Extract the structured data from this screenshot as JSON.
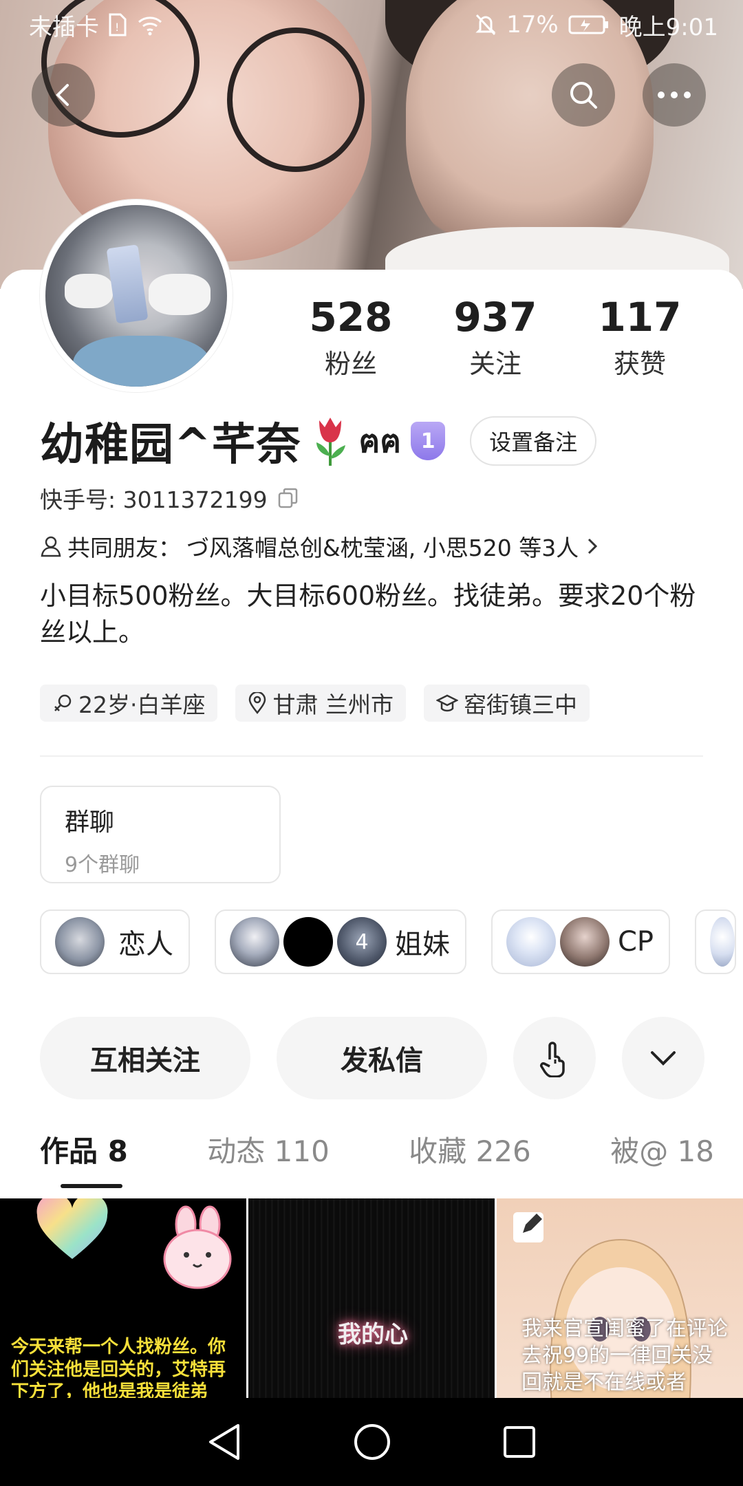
{
  "status_bar": {
    "carrier": "未插卡",
    "battery": "17%",
    "time": "晚上9:01"
  },
  "profile": {
    "name": "幼稚园^芊奈",
    "kaomoji": "ฅฅ",
    "badge_level": "1",
    "remark_button": "设置备注",
    "uid_label": "快手号:",
    "uid": "3011372199",
    "mutual_label": "共同朋友：",
    "mutual_text": "づ风落帽总创&枕莹涵, 小思520 等3人",
    "bio": "小目标500粉丝。大目标600粉丝。找徒弟。要求20个粉丝以上。"
  },
  "stats": [
    {
      "value": "528",
      "label": "粉丝"
    },
    {
      "value": "937",
      "label": "关注"
    },
    {
      "value": "117",
      "label": "获赞"
    }
  ],
  "tags": [
    {
      "icon": "gender-female-icon",
      "label": "22岁·白羊座"
    },
    {
      "icon": "location-pin-icon",
      "label": "甘肃 兰州市"
    },
    {
      "icon": "school-cap-icon",
      "label": "窑街镇三中"
    }
  ],
  "group": {
    "title": "群聊",
    "subtitle": "9个群聊"
  },
  "relations": [
    {
      "label": "恋人",
      "count": ""
    },
    {
      "label": "姐妹",
      "count": "4"
    },
    {
      "label": "CP",
      "count": ""
    }
  ],
  "actions": {
    "mutual_follow": "互相关注",
    "message": "发私信"
  },
  "tabs": [
    {
      "label": "作品 8"
    },
    {
      "label": "动态 110"
    },
    {
      "label": "收藏 226"
    },
    {
      "label": "被@ 18"
    }
  ],
  "thumbnails": [
    {
      "caption": "今天来帮一个人找粉丝。你们关注他是回关的，艾特再下方了，他也是我是徒弟"
    },
    {
      "caption": "我的心"
    },
    {
      "caption": "我来官宣闺蜜了在评论去祝99的一律回关没回就是不在线或者"
    }
  ],
  "colors": {
    "accent_purple": "#8d78ea",
    "tulip_red": "#d9344a",
    "text_primary": "#1c1c1c",
    "text_secondary": "#9a9a9a",
    "chip_bg": "#f4f4f5"
  }
}
